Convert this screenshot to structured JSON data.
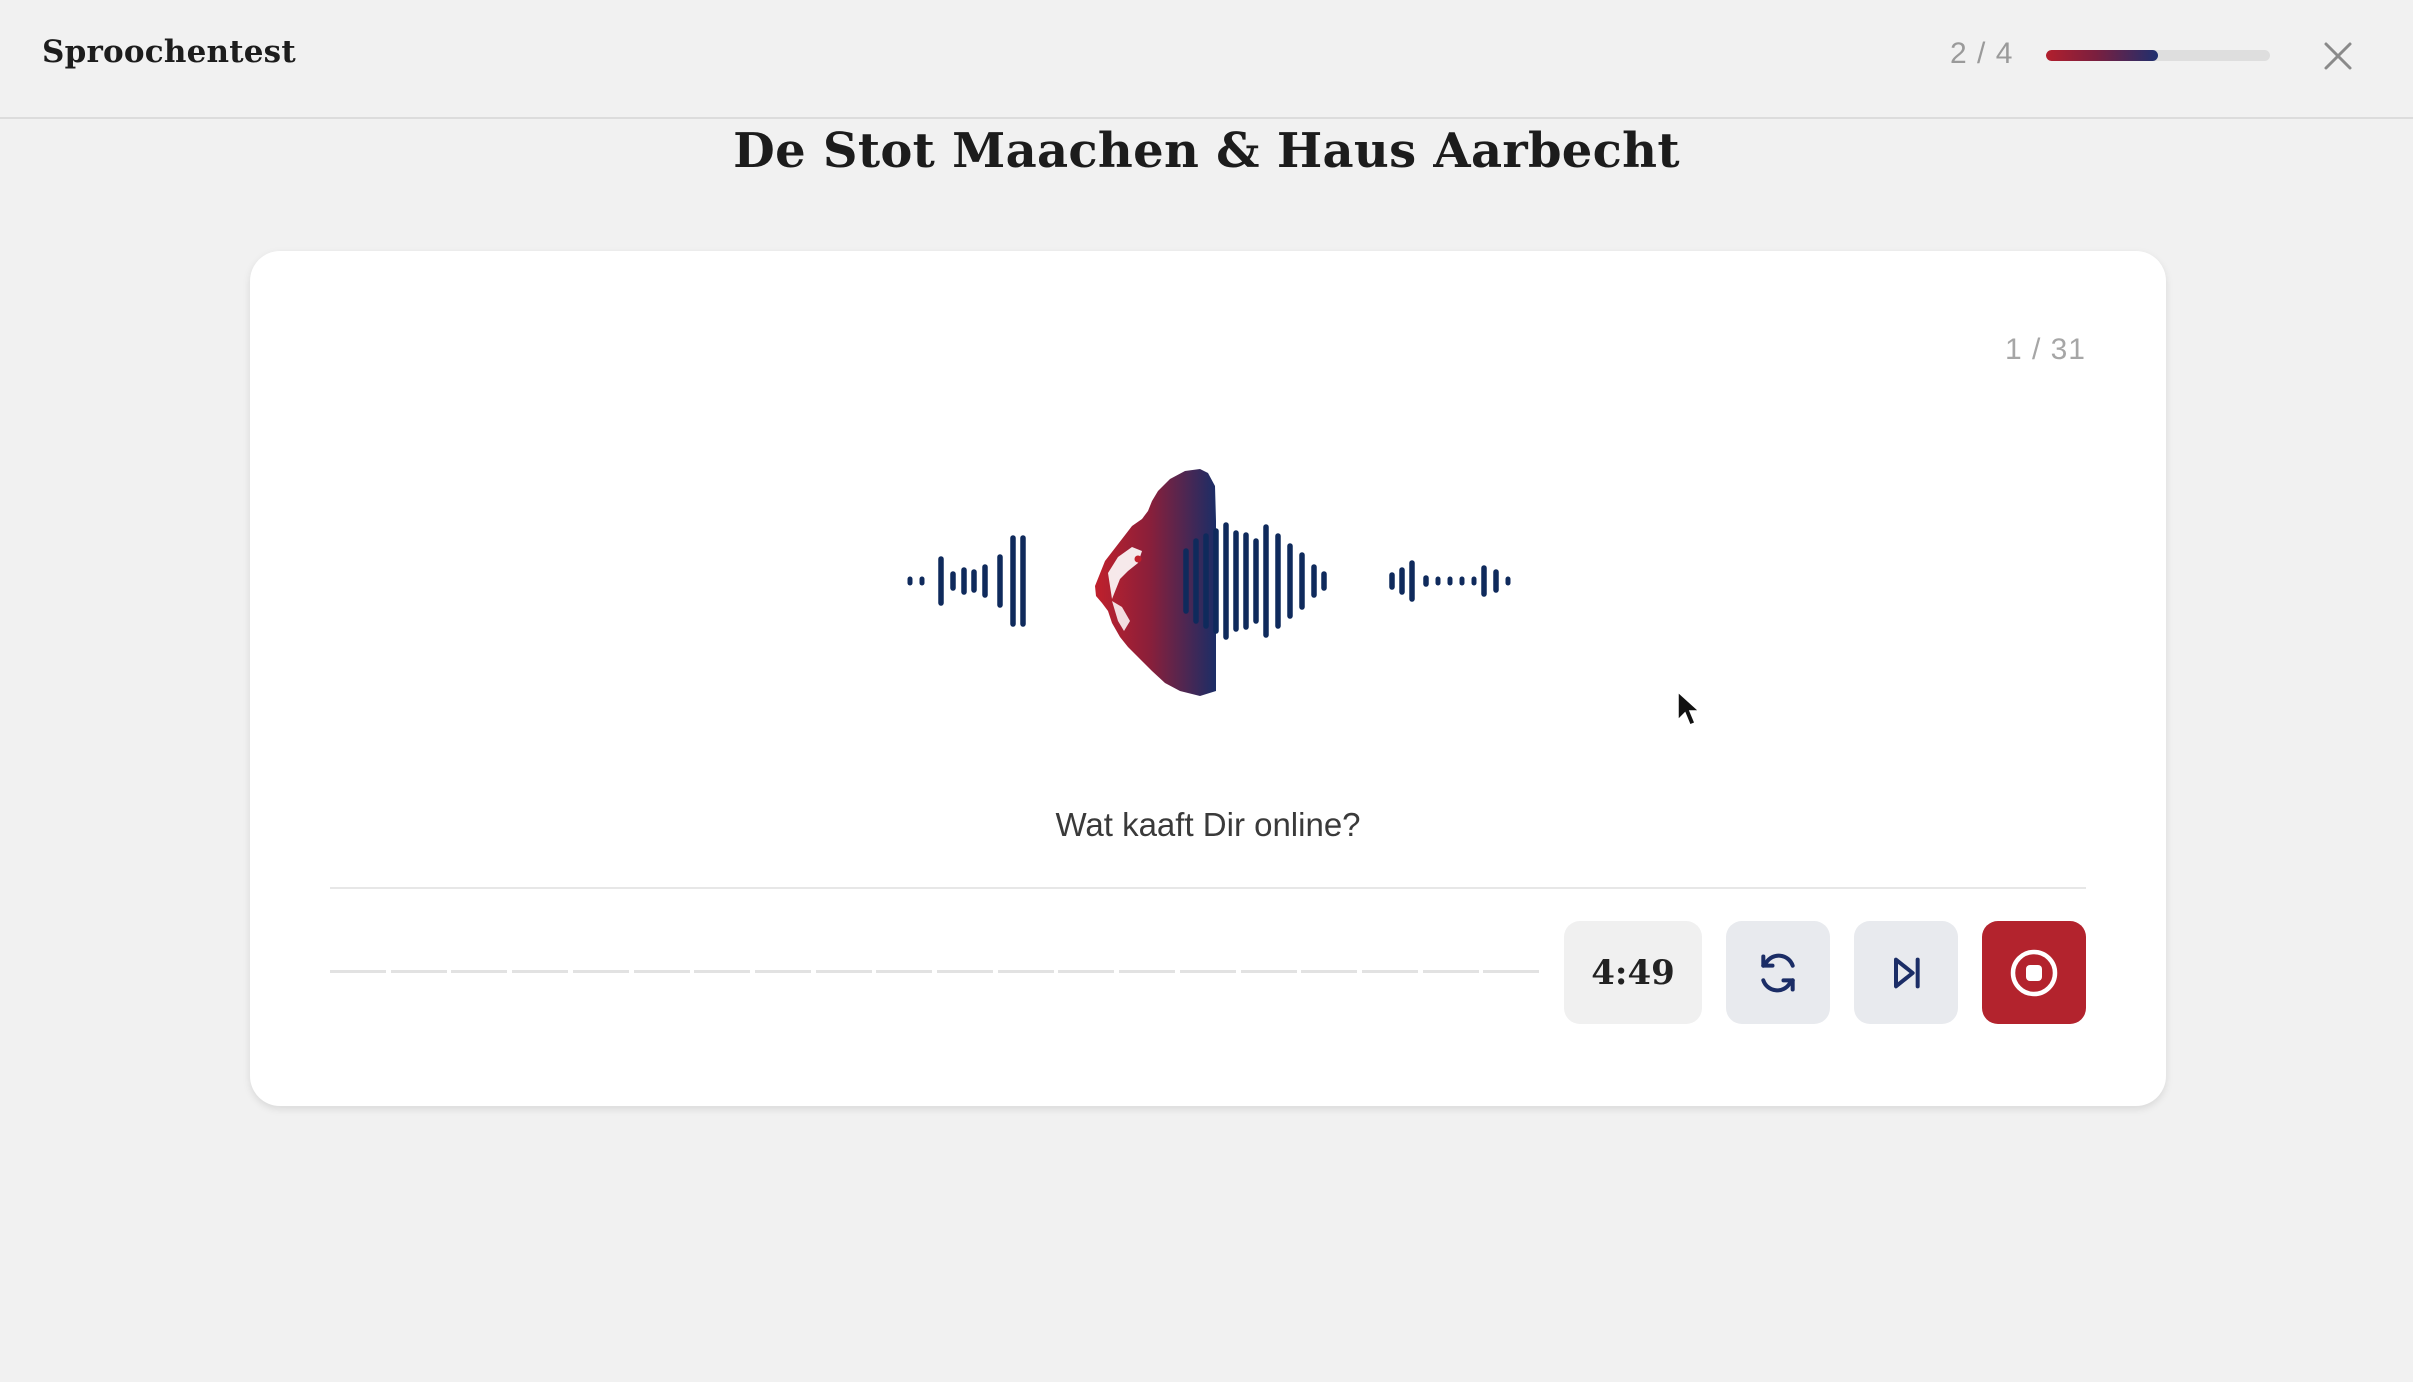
{
  "header": {
    "app_title": "Sproochentest",
    "step_counter": "2 / 4",
    "progress_fraction": 0.5,
    "close_icon": "close-icon"
  },
  "page": {
    "title": "De Stot Maachen & Haus Aarbecht"
  },
  "card": {
    "question_counter": "1 / 31",
    "logo": "lion-soundwave-logo",
    "question_text": "Wat kaaft Dir online?",
    "timer": "4:49",
    "buttons": {
      "restart_icon": "refresh-icon",
      "skip_icon": "skip-next-icon",
      "record_icon": "stop-record-icon"
    }
  },
  "colors": {
    "accent_red": "#b3232d",
    "navy": "#1e2f6e",
    "background": "#f1f1f1"
  }
}
